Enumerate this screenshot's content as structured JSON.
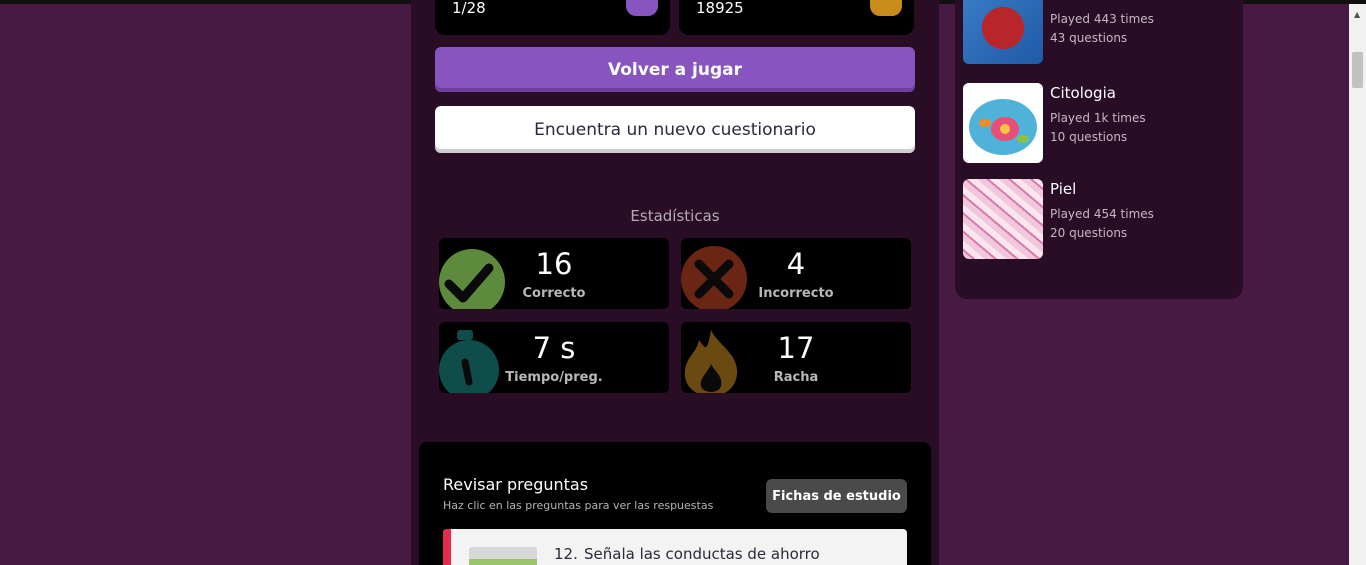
{
  "summary": {
    "rank": "1/28",
    "points": "18925"
  },
  "buttons": {
    "play_again": "Volver a jugar",
    "new_quiz": "Encuentra un nuevo cuestionario"
  },
  "stats": {
    "title": "Estadísticas",
    "correct": {
      "value": "16",
      "label": "Correcto"
    },
    "incorrect": {
      "value": "4",
      "label": "Incorrecto"
    },
    "time_per_question": {
      "value": "7 s",
      "label": "Tiempo/preg."
    },
    "streak": {
      "value": "17",
      "label": "Racha"
    }
  },
  "review": {
    "title": "Revisar preguntas",
    "subtitle": "Haz clic en las preguntas para ver las respuestas",
    "flashcards_label": "Fichas de estudio",
    "question": {
      "number": "12.",
      "text": "Señala las conductas de ahorro"
    }
  },
  "related_quizzes": [
    {
      "name": "",
      "played": "Played 443 times",
      "questions": "43 questions",
      "icon": "heart-anatomy-image"
    },
    {
      "name": "Citologia",
      "played": "Played 1k times",
      "questions": "10 questions",
      "icon": "cell-diagram-image"
    },
    {
      "name": "Piel",
      "played": "Played 454 times",
      "questions": "20 questions",
      "icon": "skin-tissue-image"
    }
  ],
  "colors": {
    "page_bg": "#461a42",
    "panel_bg": "#280d25",
    "accent_purple": "#8854c0",
    "gold": "#c98b1a",
    "incorrect_red": "#e5294f"
  }
}
